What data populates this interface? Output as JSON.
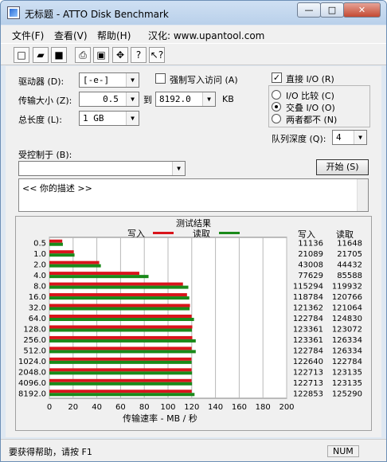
{
  "window": {
    "title": "无标题 - ATTO Disk Benchmark",
    "min": "—",
    "max": "□",
    "close": "✕"
  },
  "menu": [
    "文件(F)",
    "查看(V)",
    "帮助(H)",
    "汉化: www.upantool.com"
  ],
  "toolbar_icons": [
    "new-icon",
    "open-icon",
    "save-icon",
    "print-icon",
    "print-preview-icon",
    "move-icon",
    "help-icon",
    "context-help-icon"
  ],
  "settings": {
    "drive_label": "驱动器 (D):",
    "drive_value": "[-e-]",
    "force_write_label": "强制写入访问 (A)",
    "transfer_label": "传输大小 (Z):",
    "transfer_from": "0.5",
    "to_label": "到",
    "transfer_to": "8192.0",
    "kb_label": "KB",
    "length_label": "总长度 (L):",
    "length_value": "1 GB",
    "direct_io_label": "直接 I/O (R)",
    "io_compare_label": "I/O 比较 (C)",
    "overlapped_io_label": "交叠 I/O (O)",
    "neither_label": "两者都不 (N)",
    "queue_label": "队列深度 (Q):",
    "queue_value": "4",
    "controlled_by_label": "受控制于 (B):",
    "controlled_by_value": "",
    "start_button": "开始 (S)",
    "description": "<<  你的描述   >>"
  },
  "chart_data": {
    "type": "bar",
    "title": "测试结果",
    "legend": [
      {
        "name": "写入",
        "color": "#d9141b"
      },
      {
        "name": "读取",
        "color": "#1a8a1a"
      }
    ],
    "categories": [
      "0.5",
      "1.0",
      "2.0",
      "4.0",
      "8.0",
      "16.0",
      "32.0",
      "64.0",
      "128.0",
      "256.0",
      "512.0",
      "1024.0",
      "2048.0",
      "4096.0",
      "8192.0"
    ],
    "series": [
      {
        "name": "写入",
        "color": "#d9141b",
        "values": [
          11136,
          21089,
          43008,
          77629,
          115294,
          118784,
          121362,
          122784,
          123361,
          123361,
          122784,
          122640,
          122713,
          122713,
          122853
        ]
      },
      {
        "name": "读取",
        "color": "#1a8a1a",
        "values": [
          11648,
          21705,
          44432,
          85588,
          119932,
          120766,
          121064,
          124830,
          123072,
          126334,
          126334,
          122784,
          123135,
          123135,
          125290
        ]
      }
    ],
    "xlabel": "传输速率 - MB / 秒",
    "xlim": [
      0,
      200
    ],
    "xticks": [
      "0",
      "20",
      "40",
      "60",
      "80",
      "100",
      "120",
      "140",
      "160",
      "180",
      "200"
    ],
    "grid": true,
    "write_column_label": "写入",
    "read_column_label": "读取"
  },
  "status": {
    "help_text": "要获得帮助，请按 F1",
    "indicator": "NUM"
  }
}
